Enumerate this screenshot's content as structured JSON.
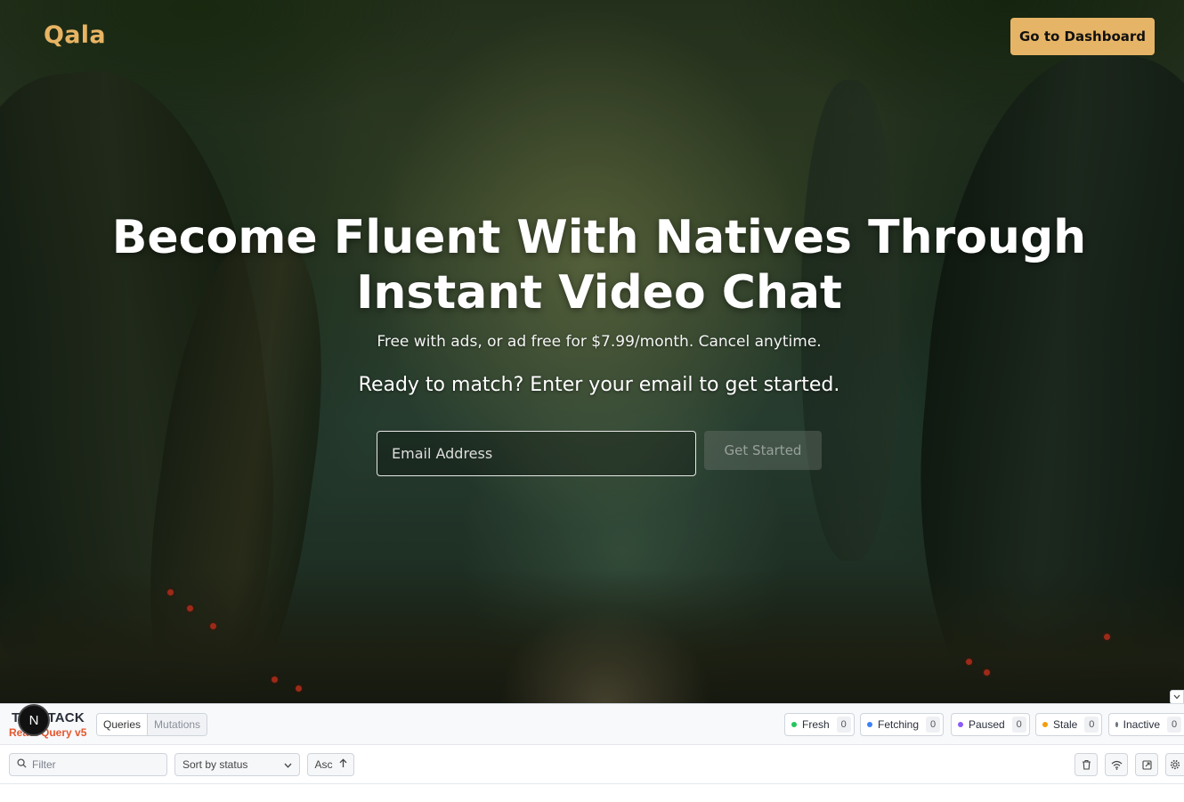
{
  "header": {
    "logo": "Qala",
    "dashboard_button": "Go to Dashboard"
  },
  "hero": {
    "headline": "Become Fluent With Natives Through Instant Video Chat",
    "pricing": "Free with ads, or ad free for $7.99/month. Cancel anytime.",
    "prompt": "Ready to match? Enter your email to get started.",
    "email_placeholder": "Email Address",
    "cta_button": "Get Started"
  },
  "devtools": {
    "brand_top": "TANSTACK",
    "brand_bottom": "React Query v5",
    "next_badge": "N",
    "tabs": [
      "Queries",
      "Mutations"
    ],
    "statuses": [
      {
        "label": "Fresh",
        "count": "0",
        "color": "#22c55e"
      },
      {
        "label": "Fetching",
        "count": "0",
        "color": "#3b82f6"
      },
      {
        "label": "Paused",
        "count": "0",
        "color": "#8b5cf6"
      },
      {
        "label": "Stale",
        "count": "0",
        "color": "#f59e0b"
      },
      {
        "label": "Inactive",
        "count": "0",
        "color": "#6b7280"
      }
    ],
    "filter_placeholder": "Filter",
    "sort_label": "Sort by status",
    "order_label": "Asc"
  },
  "colors": {
    "accent": "#e6b466",
    "logo": "#e8b463"
  }
}
